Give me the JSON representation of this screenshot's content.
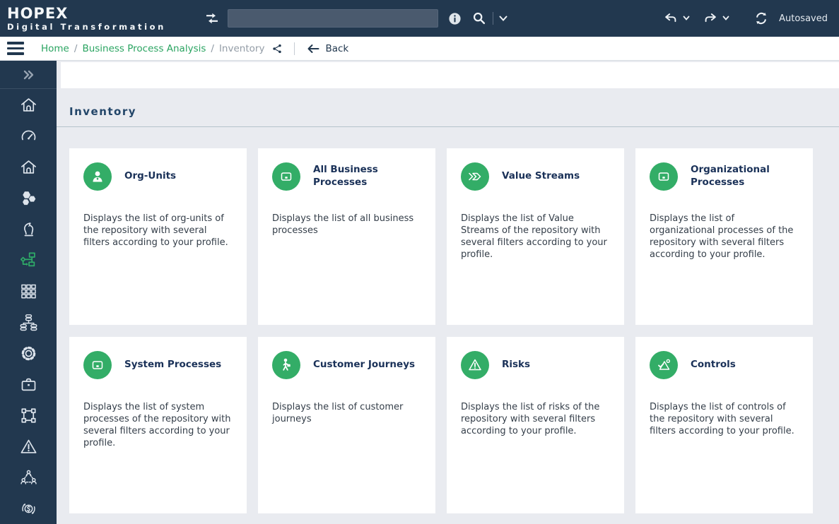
{
  "header": {
    "logo_title": "HOPEX",
    "logo_subtitle": "Digital Transformation",
    "search": {
      "value": "",
      "placeholder": ""
    },
    "icons": [
      "transfer-icon",
      "info-icon",
      "search-icon",
      "chevron-down-icon",
      "undo-icon",
      "redo-icon",
      "sync-icon"
    ],
    "autosaved_label": "Autosaved"
  },
  "breadcrumb": {
    "home": "Home",
    "section": "Business Process Analysis",
    "current": "Inventory",
    "separator": "/",
    "back_label": "Back"
  },
  "sidebar": {
    "items": [
      "expand-chevrons",
      "home",
      "dashboard-gauge",
      "home-alt",
      "hexagons",
      "strategy-knight",
      "process-flowchart-active",
      "apps-grid",
      "data-architecture",
      "settings-gear",
      "portfolio-briefcase",
      "diagram-selection",
      "risk-warning",
      "org-collaboration",
      "currency-sync"
    ]
  },
  "page": {
    "title": "Inventory"
  },
  "cards": [
    {
      "icon": "org-unit-person",
      "title": "Org-Units",
      "description": "Displays the list of org-units of the repository with several filters according to your profile."
    },
    {
      "icon": "process-screen",
      "title": "All Business Processes",
      "description": "Displays the list of all business processes"
    },
    {
      "icon": "value-stream-arrow",
      "title": "Value Streams",
      "description": "Displays the list of Value Streams of the repository with several filters according to your profile."
    },
    {
      "icon": "process-screen",
      "title": "Organizational Processes",
      "description": "Displays the list of organizational processes of the repository with several filters according to your profile."
    },
    {
      "icon": "process-screen",
      "title": "System Processes",
      "description": "Displays the list of system processes of the repository with several filters according to your profile."
    },
    {
      "icon": "customer-journey-person",
      "title": "Customer Journeys",
      "description": "Displays the list of customer journeys"
    },
    {
      "icon": "risk-triangle",
      "title": "Risks",
      "description": "Displays the list of risks of the repository with several filters according to your profile."
    },
    {
      "icon": "controls-check-triangle",
      "title": "Controls",
      "description": "Displays the list of controls of the repository with several filters according to your profile."
    }
  ],
  "colors": {
    "header_bg": "#22384f",
    "accent_green": "#33ad67",
    "link_green": "#2aa461",
    "content_bg": "#e9ebf0",
    "title_navy": "#234669"
  }
}
